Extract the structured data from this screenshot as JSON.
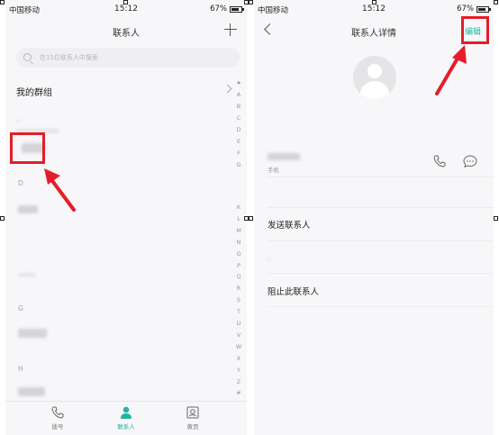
{
  "status_bar": {
    "carrier": "中国移动",
    "time": "15:12",
    "battery": "67%"
  },
  "contacts_screen": {
    "title": "联系人",
    "search_placeholder": "在15位联系人中搜索",
    "groups_label": "我的群组",
    "section_d": "D",
    "section_g": "G",
    "section_h": "H",
    "index_letters": [
      "★",
      "A",
      "B",
      "C",
      "D",
      "E",
      "F",
      "G",
      "K",
      "L",
      "M",
      "N",
      "O",
      "P",
      "Q",
      "R",
      "S",
      "T",
      "U",
      "V",
      "W",
      "X",
      "Y",
      "Z",
      "#"
    ],
    "tabs": [
      {
        "label": "拨号",
        "icon": "phone-icon"
      },
      {
        "label": "联系人",
        "icon": "person-icon"
      },
      {
        "label": "黄页",
        "icon": "yellow-pages-icon"
      }
    ]
  },
  "detail_screen": {
    "title": "联系人详情",
    "edit_label": "编辑",
    "phone_type": "手机",
    "send_contact": "发送联系人",
    "block_contact": "阻止此联系人"
  },
  "colors": {
    "accent": "#24b3a5",
    "highlight": "#e51d2a"
  }
}
